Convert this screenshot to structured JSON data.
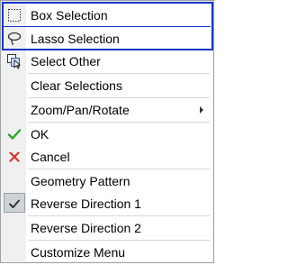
{
  "menu": {
    "items": [
      {
        "label": "Box Selection",
        "icon": "box-selection-icon"
      },
      {
        "label": "Lasso Selection",
        "icon": "lasso-icon"
      },
      {
        "label": "Select Other",
        "icon": "select-other-icon"
      },
      {
        "label": "Clear Selections",
        "icon": ""
      },
      {
        "label": "Zoom/Pan/Rotate",
        "icon": "",
        "submenu": true
      },
      {
        "label": "OK",
        "icon": "check-icon"
      },
      {
        "label": "Cancel",
        "icon": "x-icon"
      },
      {
        "label": "Geometry Pattern",
        "icon": ""
      },
      {
        "label": "Reverse Direction 1",
        "icon": "check-icon",
        "checked": true
      },
      {
        "label": "Reverse Direction 2",
        "icon": ""
      },
      {
        "label": "Customize Menu",
        "icon": ""
      }
    ]
  },
  "colors": {
    "highlight_border": "#1836c8",
    "ok_check": "#2aa52a",
    "cancel_x": "#d9342b",
    "checked_bg": "#cfd3d8"
  }
}
